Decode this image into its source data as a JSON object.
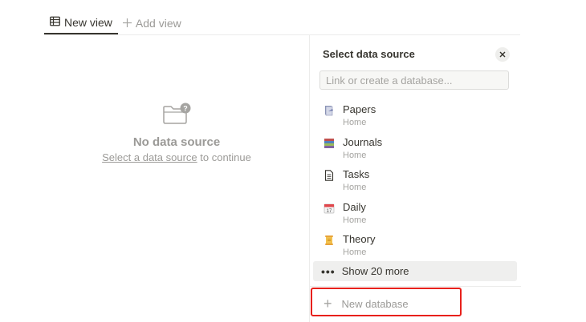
{
  "tabs": {
    "active": {
      "label": "New view",
      "icon": "table-icon"
    },
    "add": {
      "label": "Add view",
      "icon": "plus-icon"
    }
  },
  "empty_state": {
    "title": "No data source",
    "link_text": "Select a data source",
    "suffix": " to continue",
    "icon": "folder-question-icon"
  },
  "panel": {
    "title": "Select data source",
    "close_icon": "close-icon",
    "search": {
      "placeholder": "Link or create a database...",
      "value": ""
    },
    "items": [
      {
        "name": "Papers",
        "parent": "Home",
        "icon": "paper-icon"
      },
      {
        "name": "Journals",
        "parent": "Home",
        "icon": "books-icon"
      },
      {
        "name": "Tasks",
        "parent": "Home",
        "icon": "page-icon"
      },
      {
        "name": "Daily",
        "parent": "Home",
        "icon": "calendar-icon"
      },
      {
        "name": "Theory",
        "parent": "Home",
        "icon": "scroll-icon"
      }
    ],
    "show_more": "Show 20 more",
    "new_database": "New database"
  },
  "colors": {
    "highlight": "#e8201b",
    "muted_text": "#9b9a97",
    "text": "#37352f"
  }
}
